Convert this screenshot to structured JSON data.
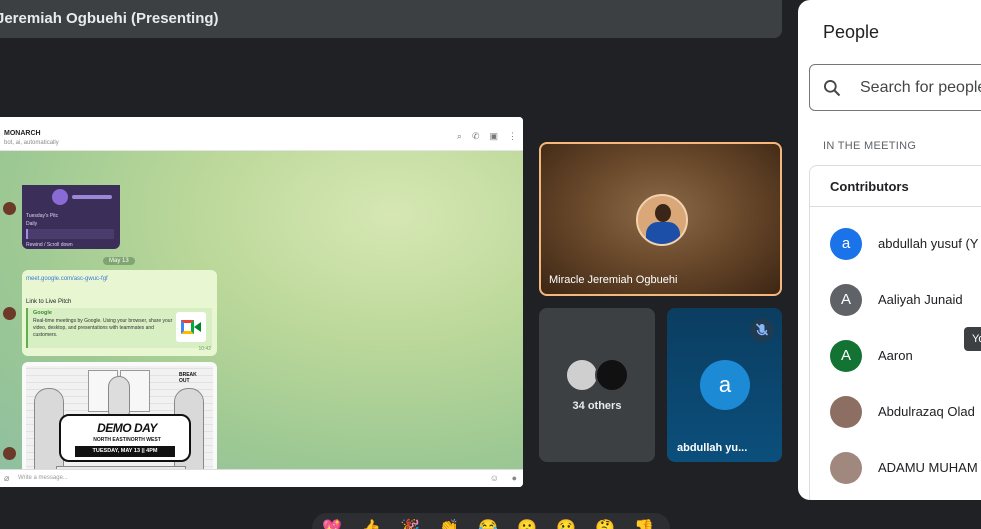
{
  "presenting_bar": {
    "title": "Jeremiah Ogbuehi (Presenting)"
  },
  "shared_screen": {
    "chat_name": "MONARCH",
    "chat_subtitle": "bot, ai, automatically",
    "voice_msg": {
      "line1": "Tuesday's Pitc",
      "line2": "Daily",
      "line3": "Rewind / Scroll down"
    },
    "date_chip": "May 13",
    "link_bubble": {
      "url": "meet.google.com/asc-gwuc-fgf",
      "text": "Link to Live Pitch",
      "preview_title": "Google",
      "preview_desc": "Real-time meetings by Google. Using your browser, share your video, desktop, and presentations with teammates and customers.",
      "time": "10:42"
    },
    "poster": {
      "title": "DEMO DAY",
      "subtitle": "NORTH EAST/NORTH WEST",
      "date": "TUESDAY, MAY 13 || 4PM",
      "logo": "BREAK OUT"
    },
    "composer_placeholder": "Write a message..."
  },
  "tiles": {
    "main": {
      "name": "Miracle Jeremiah Ogbuehi"
    },
    "others": {
      "count": "34 others"
    },
    "abdullah": {
      "initial": "a",
      "name": "abdullah yu..."
    }
  },
  "people_panel": {
    "title": "People",
    "search_placeholder": "Search for people",
    "section_label": "IN THE MEETING",
    "group_header": "Contributors",
    "participants": [
      {
        "initial": "a",
        "name": "abdullah yusuf (Y",
        "color": "#1a73e8"
      },
      {
        "initial": "A",
        "name": "Aaliyah Junaid",
        "color": "#5f6368"
      },
      {
        "initial": "A",
        "name": "Aaron",
        "color": "#137333"
      },
      {
        "initial": "",
        "name": "Abdulrazaq Olad",
        "color": "#8d6e63"
      },
      {
        "initial": "",
        "name": "ADAMU MUHAM",
        "color": "#a1887f"
      }
    ]
  },
  "tooltip": {
    "text": "Yo"
  },
  "reactions": [
    "💖",
    "👍",
    "🎉",
    "👏",
    "😂",
    "😮",
    "😢",
    "🤔",
    "👎"
  ]
}
